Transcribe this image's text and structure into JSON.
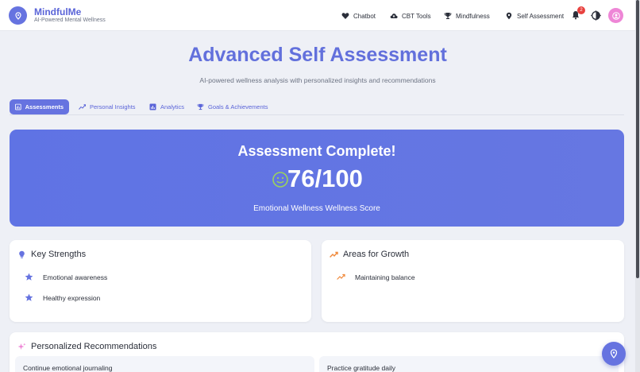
{
  "app": {
    "name": "MindfulMe",
    "tagline": "AI-Powered Mental Wellness"
  },
  "nav": {
    "items": [
      {
        "label": "Chatbot",
        "icon": "heart-icon"
      },
      {
        "label": "CBT Tools",
        "icon": "cloud-upload-icon"
      },
      {
        "label": "Mindfulness",
        "icon": "trophy-icon"
      },
      {
        "label": "Self Assessment",
        "icon": "location-pin-icon"
      }
    ],
    "notification_count": "2"
  },
  "page": {
    "title": "Advanced Self Assessment",
    "subtitle": "AI-powered wellness analysis with personalized insights and recommendations"
  },
  "tabs": [
    {
      "label": "Assessments",
      "icon": "chart-icon",
      "active": true
    },
    {
      "label": "Personal Insights",
      "icon": "trend-icon",
      "active": false
    },
    {
      "label": "Analytics",
      "icon": "bar-chart-icon",
      "active": false
    },
    {
      "label": "Goals & Achievements",
      "icon": "trophy-icon",
      "active": false
    }
  ],
  "result": {
    "title": "Assessment Complete!",
    "score": "76/100",
    "score_value": 76,
    "score_max": 100,
    "caption": "Emotional Wellness Wellness Score"
  },
  "strengths": {
    "title": "Key Strengths",
    "items": [
      "Emotional awareness",
      "Healthy expression"
    ]
  },
  "growth": {
    "title": "Areas for Growth",
    "items": [
      "Maintaining balance"
    ]
  },
  "recommendations": {
    "title": "Personalized Recommendations",
    "items": [
      "Continue emotional journaling",
      "Practice gratitude daily"
    ]
  },
  "colors": {
    "accent": "#6673e0",
    "hero": "#5f73e4",
    "growth": "#f08a3c",
    "smiley": "#9bd35c",
    "badge": "#e8413e",
    "avatar": "#ee86d6"
  }
}
